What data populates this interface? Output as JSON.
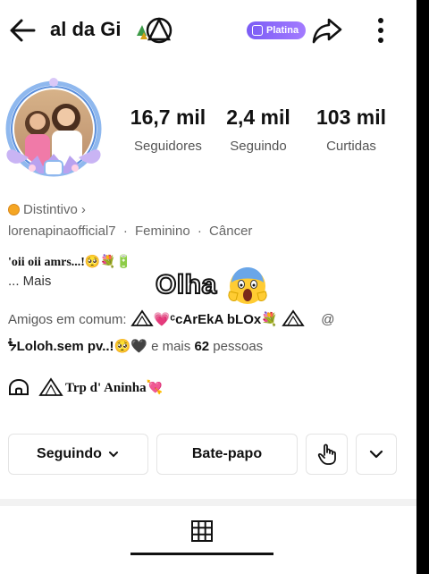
{
  "header": {
    "title": "al da Gi",
    "badge_label": "Platina"
  },
  "stats": [
    {
      "value": "16,7 mil",
      "label": "Seguidores"
    },
    {
      "value": "2,4 mil",
      "label": "Seguindo"
    },
    {
      "value": "103 mil",
      "label": "Curtidas"
    }
  ],
  "profile": {
    "distintivo_label": "Distintivo",
    "distintivo_chevron": "›",
    "username": "lorenapinaofficial7",
    "gender": "Feminino",
    "sign": "Câncer",
    "separator": "·",
    "bio_line": "'oii oii amrs...!🥺💐🔋",
    "bio_more": "...  Mais"
  },
  "overlay": {
    "text": "Olha"
  },
  "mutual": {
    "prefix": "Amigos em comum:",
    "names_line1": "💗ᶜcArEkA bLOx💐",
    "at_sign": "@",
    "name_line2": "ᖭLoloh.sem pv..!🥺🖤",
    "and_more": "e mais",
    "count": "62",
    "suffix": "pessoas"
  },
  "group": {
    "name": "Trp d' Aninha💘"
  },
  "actions": {
    "following_label": "Seguindo",
    "following_chevron": "⌄",
    "chat_label": "Bate-papo"
  },
  "colors": {
    "badge_gradient_start": "#7b5cf5",
    "badge_gradient_end": "#a37bff",
    "text_primary": "#111111",
    "text_secondary": "#666666"
  },
  "icons": {
    "back": "arrow-left-icon",
    "share": "share-arrow-icon",
    "more": "vertical-dots-icon",
    "poke": "hand-tap-icon",
    "expand": "chevron-down-icon",
    "grid": "grid-icon",
    "group": "dome-icon"
  }
}
